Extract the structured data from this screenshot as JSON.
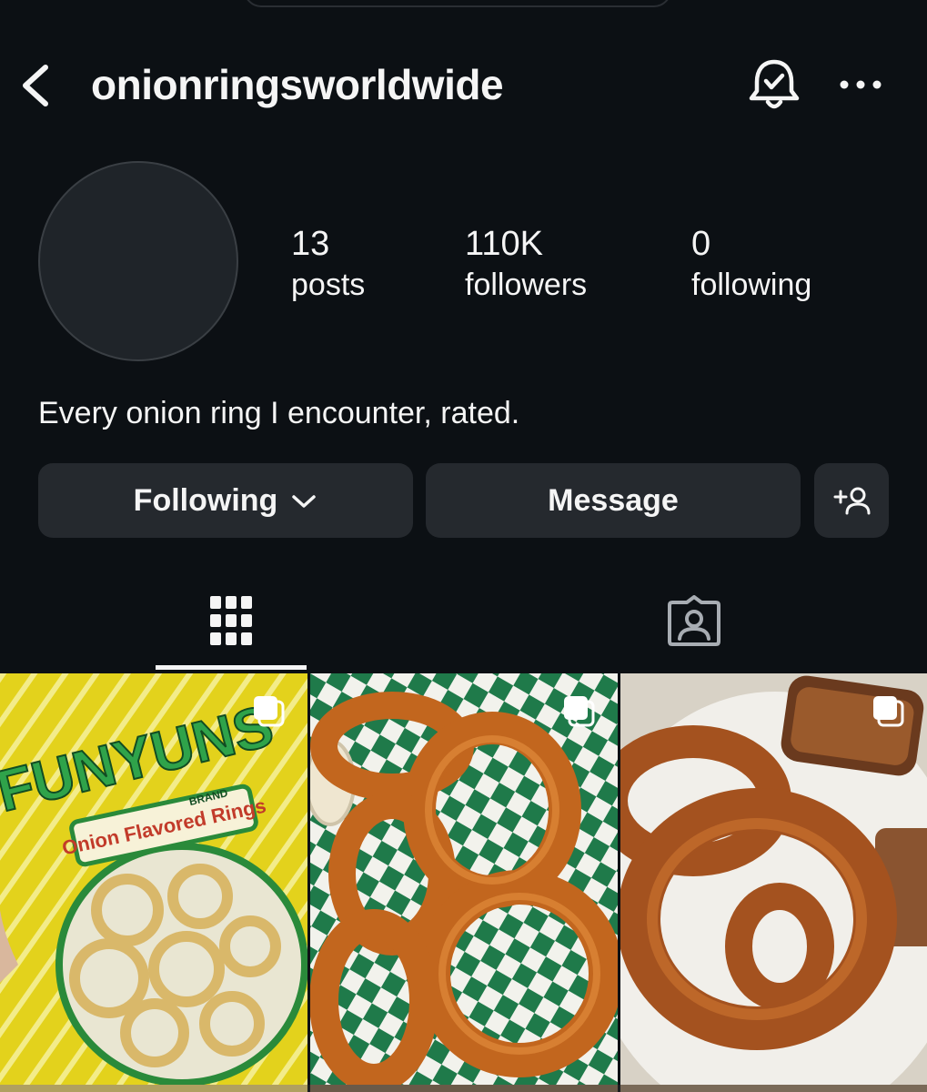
{
  "header": {
    "username": "onionringsworldwide",
    "back_icon": "chevron-left-icon",
    "bell_icon": "bell-check-icon",
    "more_icon": "more-horizontal-icon"
  },
  "profile": {
    "stats": {
      "posts_count": "13",
      "posts_label": "posts",
      "followers_count": "110K",
      "followers_label": "followers",
      "following_count": "0",
      "following_label": "following"
    },
    "bio": "Every onion ring I encounter, rated."
  },
  "actions": {
    "following_label": "Following",
    "message_label": "Message",
    "suggest_icon": "add-person-icon"
  },
  "tabs": [
    {
      "name": "posts-grid",
      "icon": "grid-icon",
      "active": true
    },
    {
      "name": "tagged",
      "icon": "tagged-person-icon",
      "active": false
    }
  ],
  "posts": [
    {
      "caption_visible_text": [
        "FUNYUNS",
        "BRAND",
        "Onion Flavored Rings"
      ],
      "multi": true
    },
    {
      "multi": true
    },
    {
      "multi": true
    }
  ],
  "funyuns": {
    "brand": "FUNYUNS",
    "brand_small": "BRAND",
    "flavor": "Onion Flavored Rings"
  },
  "colors": {
    "background": "#0c1014",
    "button_bg": "#25292e",
    "text": "#f5f5f5"
  }
}
